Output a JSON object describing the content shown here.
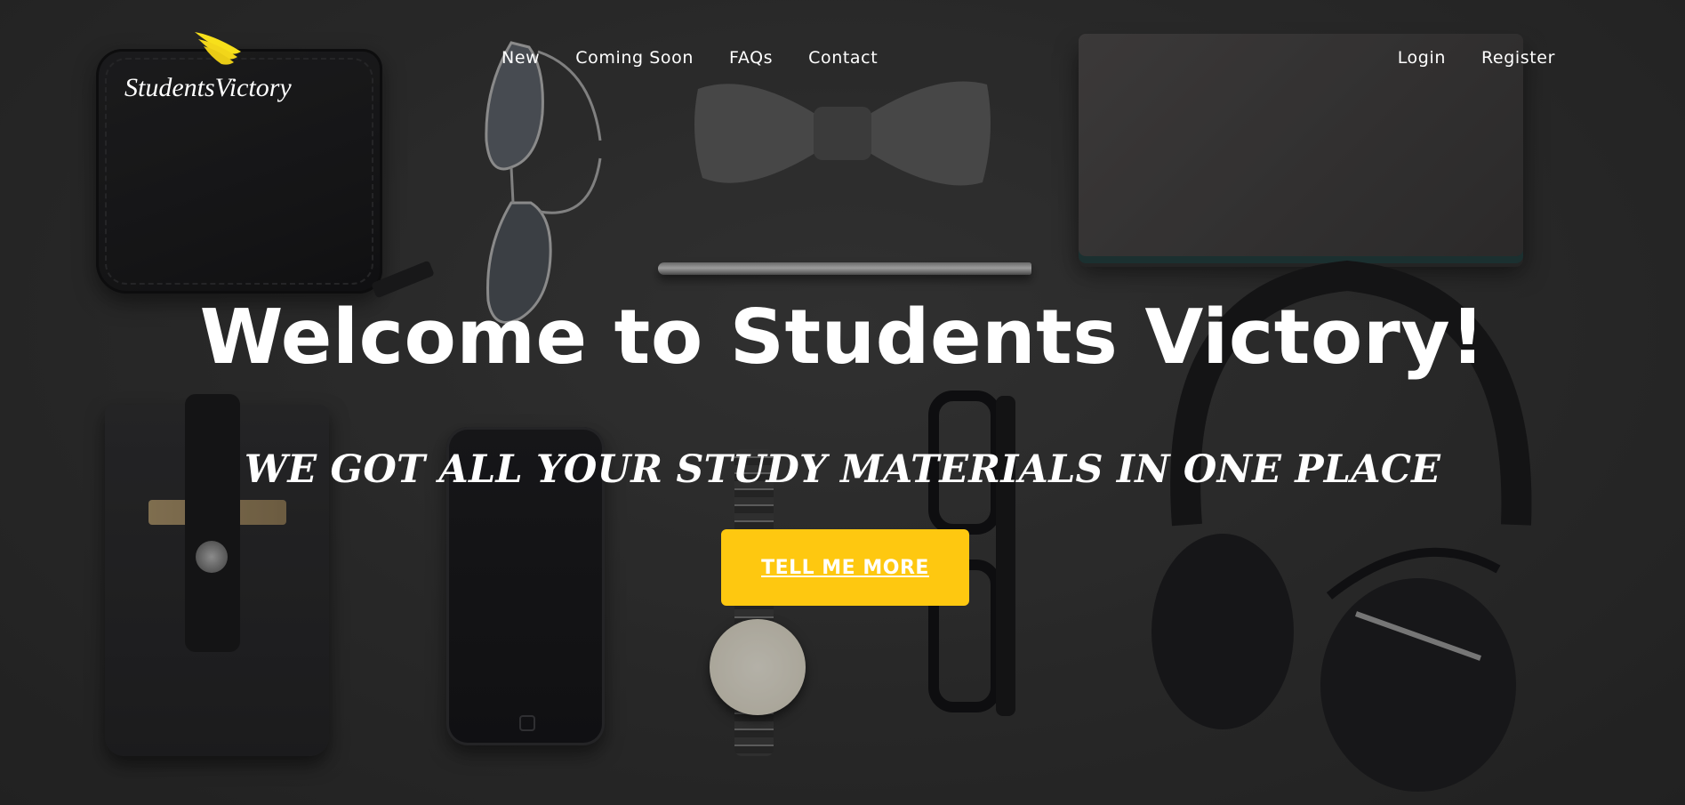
{
  "navbar": {
    "brand": {
      "name": "StudentsVictory",
      "icon": "wing-icon",
      "icon_color": "#f7e01b"
    },
    "left_links": [
      {
        "label": "New"
      },
      {
        "label": "Coming Soon"
      },
      {
        "label": "FAQs"
      },
      {
        "label": "Contact"
      }
    ],
    "right_links": [
      {
        "label": "Login"
      },
      {
        "label": "Register"
      }
    ]
  },
  "hero": {
    "title": "Welcome to Students Victory!",
    "subtitle": "WE GOT ALL YOUR STUDY MATERIALS IN ONE PLACE",
    "cta_label": "TELL ME MORE",
    "cta_color": "#fec810",
    "background_image": "flat-lay-accessories-photo"
  }
}
